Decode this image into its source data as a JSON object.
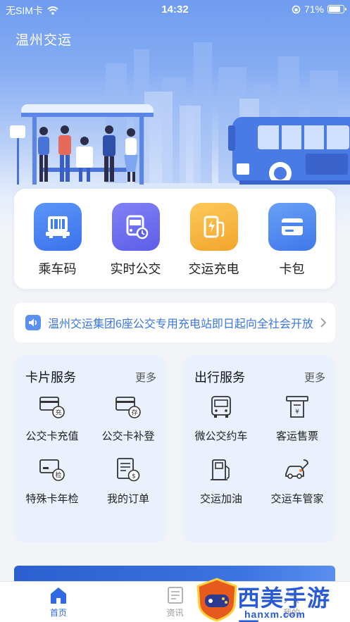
{
  "status_bar": {
    "carrier": "无SIM卡",
    "time": "14:32",
    "battery": "71%",
    "battery_level": 0.71
  },
  "header": {
    "title": "温州交运"
  },
  "quick_actions": [
    {
      "label": "乘车码",
      "icon": "ride-code-icon",
      "color": "#3f7ef2"
    },
    {
      "label": "实时公交",
      "icon": "realtime-bus-icon",
      "color": "#6b6cf0"
    },
    {
      "label": "交运充电",
      "icon": "charging-icon",
      "color": "#f5b43c"
    },
    {
      "label": "卡包",
      "icon": "wallet-icon",
      "color": "#4a86f2"
    }
  ],
  "notice": {
    "text": "温州交运集团6座公交专用充电站即日起向全社会开放"
  },
  "card_services": {
    "title": "卡片服务",
    "more": "更多",
    "items": [
      {
        "label": "公交卡充值",
        "icon": "card-recharge-icon",
        "badge": "充"
      },
      {
        "label": "公交卡补登",
        "icon": "card-supplement-icon",
        "badge": "存"
      },
      {
        "label": "特殊卡年检",
        "icon": "card-inspection-icon",
        "badge": "检"
      },
      {
        "label": "我的订单",
        "icon": "order-icon",
        "badge": "$"
      }
    ]
  },
  "travel_services": {
    "title": "出行服务",
    "more": "更多",
    "items": [
      {
        "label": "微公交约车",
        "icon": "minibus-icon"
      },
      {
        "label": "客运售票",
        "icon": "ticket-icon"
      },
      {
        "label": "交运加油",
        "icon": "fuel-icon"
      },
      {
        "label": "交运车管家",
        "icon": "car-service-icon"
      }
    ]
  },
  "tab_bar": [
    {
      "label": "首页",
      "icon": "home-icon",
      "active": true
    },
    {
      "label": "资讯",
      "icon": "news-icon",
      "active": false
    },
    {
      "label": "我的",
      "icon": "profile-icon",
      "active": false
    }
  ],
  "watermark": {
    "text": "西美手游网",
    "url": "hanxm.com"
  },
  "colors": {
    "accent": "#2f6ae0",
    "notice": "#3a76e0",
    "service_bg": "#eaf1fd"
  }
}
